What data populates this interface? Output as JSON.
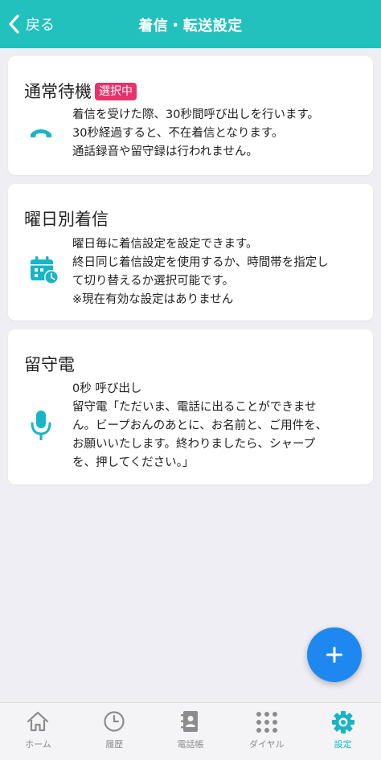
{
  "header": {
    "back_label": "戻る",
    "title": "着信・転送設定",
    "bg_color": "#22c1bd"
  },
  "cards": [
    {
      "title": "通常待機",
      "badge": "選択中",
      "icon": "phone-icon",
      "lines": [
        "着信を受けた際、30秒間呼び出しを行います。",
        "30秒経過すると、不在着信となります。",
        "通話録音や留守録は行われません。"
      ]
    },
    {
      "title": "曜日別着信",
      "icon": "calendar-clock-icon",
      "lines": [
        "曜日毎に着信設定を設定できます。",
        "終日同じ着信設定を使用するか、時間帯を指定し",
        "て切り替えるか選択可能です。",
        "※現在有効な設定はありません"
      ]
    },
    {
      "title": "留守電",
      "icon": "microphone-icon",
      "lines": [
        "0秒 呼び出し",
        "留守電「ただいま、電話に出ることができませ",
        "ん。ビープおんのあとに、お名前と、ご用件を、",
        "お願いいたします。終わりましたら、シャープ",
        "を、押してください。」"
      ]
    }
  ],
  "fab": {
    "icon": "plus-icon",
    "color": "#1e88f0"
  },
  "tabs": [
    {
      "label": "ホーム",
      "icon": "home-icon",
      "active": false
    },
    {
      "label": "履歴",
      "icon": "clock-icon",
      "active": false
    },
    {
      "label": "電話帳",
      "icon": "contacts-book-icon",
      "active": false
    },
    {
      "label": "ダイヤル",
      "icon": "dialpad-icon",
      "active": false
    },
    {
      "label": "設定",
      "icon": "gear-icon",
      "active": true
    }
  ],
  "colors": {
    "accent": "#17b5c6",
    "badge": "#e8326b",
    "background": "#eeeef4"
  }
}
